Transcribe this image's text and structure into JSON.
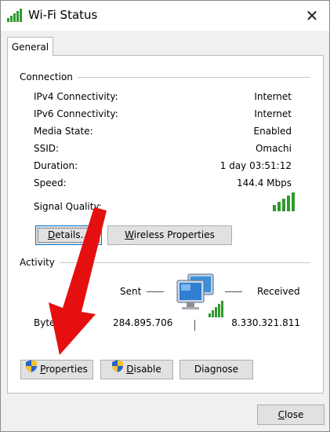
{
  "window": {
    "title": "Wi-Fi Status",
    "close_glyph": "✕"
  },
  "tabs": [
    {
      "label": "General"
    }
  ],
  "connection": {
    "heading": "Connection",
    "rows": [
      {
        "label": "IPv4 Connectivity:",
        "value": "Internet"
      },
      {
        "label": "IPv6 Connectivity:",
        "value": "Internet"
      },
      {
        "label": "Media State:",
        "value": "Enabled"
      },
      {
        "label": "SSID:",
        "value": "Omachi"
      },
      {
        "label": "Duration:",
        "value": "1 day 03:51:12"
      },
      {
        "label": "Speed:",
        "value": "144.4 Mbps"
      }
    ],
    "signal_label": "Signal Quality:",
    "signal_bars": 5,
    "details_button": {
      "prefix": "",
      "mnemonic": "D",
      "rest": "etails..."
    },
    "wireless_button": {
      "mnemonic": "W",
      "rest": "ireless Properties"
    }
  },
  "activity": {
    "heading": "Activity",
    "sent_label": "Sent",
    "received_label": "Received",
    "bytes_label": "Bytes:",
    "bytes_sent": "284.895.706",
    "bytes_received": "8.330.321.811"
  },
  "buttons": {
    "properties": {
      "mnemonic": "P",
      "rest": "roperties"
    },
    "disable": {
      "mnemonic": "D",
      "rest": "isable"
    },
    "diagnose": {
      "label": "Diagnose"
    },
    "close": {
      "mnemonic": "C",
      "rest": "lose"
    }
  },
  "colors": {
    "signal_green": "#2e9a2e",
    "annotation_arrow": "#e50f0f",
    "focus_blue": "#0078d7"
  },
  "icons": [
    "wifi-signal-icon",
    "close-icon",
    "network-computers-icon",
    "uac-shield-icon",
    "red-arrow-annotation"
  ]
}
